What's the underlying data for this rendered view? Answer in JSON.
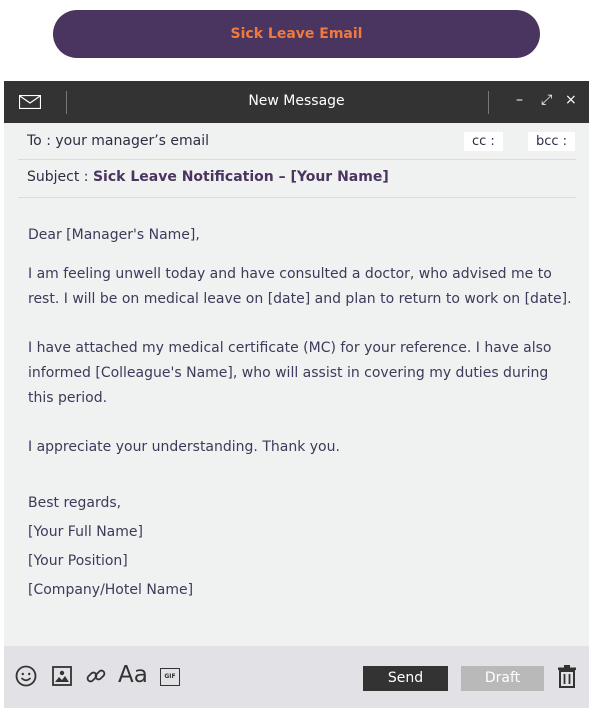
{
  "banner": {
    "title": "Sick Leave Email"
  },
  "window": {
    "title": "New Message",
    "controls": {
      "minimize": "–",
      "expand": "⤢",
      "close": "×"
    }
  },
  "compose": {
    "to_label": "To :",
    "to_value": "your manager’s email",
    "cc_label": "cc :",
    "bcc_label": "bcc :",
    "subject_label": "Subject :",
    "subject_value": "Sick Leave Notification – [Your Name]"
  },
  "body": {
    "greeting": "Dear [Manager's Name],",
    "para1": "I am feeling unwell today and have consulted a doctor, who advised me to rest. I will be on medical leave on [date] and plan to return to work on [date].",
    "para2": "I have attached my medical certificate (MC) for your reference. I have also informed [Colleague's Name], who will assist in covering my duties during this period.",
    "para3": "I appreciate your understanding. Thank you.",
    "closing": "Best regards,",
    "sig_name": "[Your Full Name]",
    "sig_position": "[Your Position]",
    "sig_company": "[Company/Hotel Name]"
  },
  "toolbar": {
    "font_label": "Aa",
    "gif_label": "GIF",
    "send_label": "Send",
    "draft_label": "Draft"
  },
  "icons": [
    "mail-icon",
    "emoji-icon",
    "image-icon",
    "link-icon",
    "font-icon",
    "gif-icon",
    "trash-icon"
  ],
  "colors": {
    "banner_bg": "#4a3560",
    "banner_text": "#f07a3e",
    "titlebar": "#333333",
    "send_bg": "#333333",
    "draft_bg": "#b9b9b9"
  }
}
